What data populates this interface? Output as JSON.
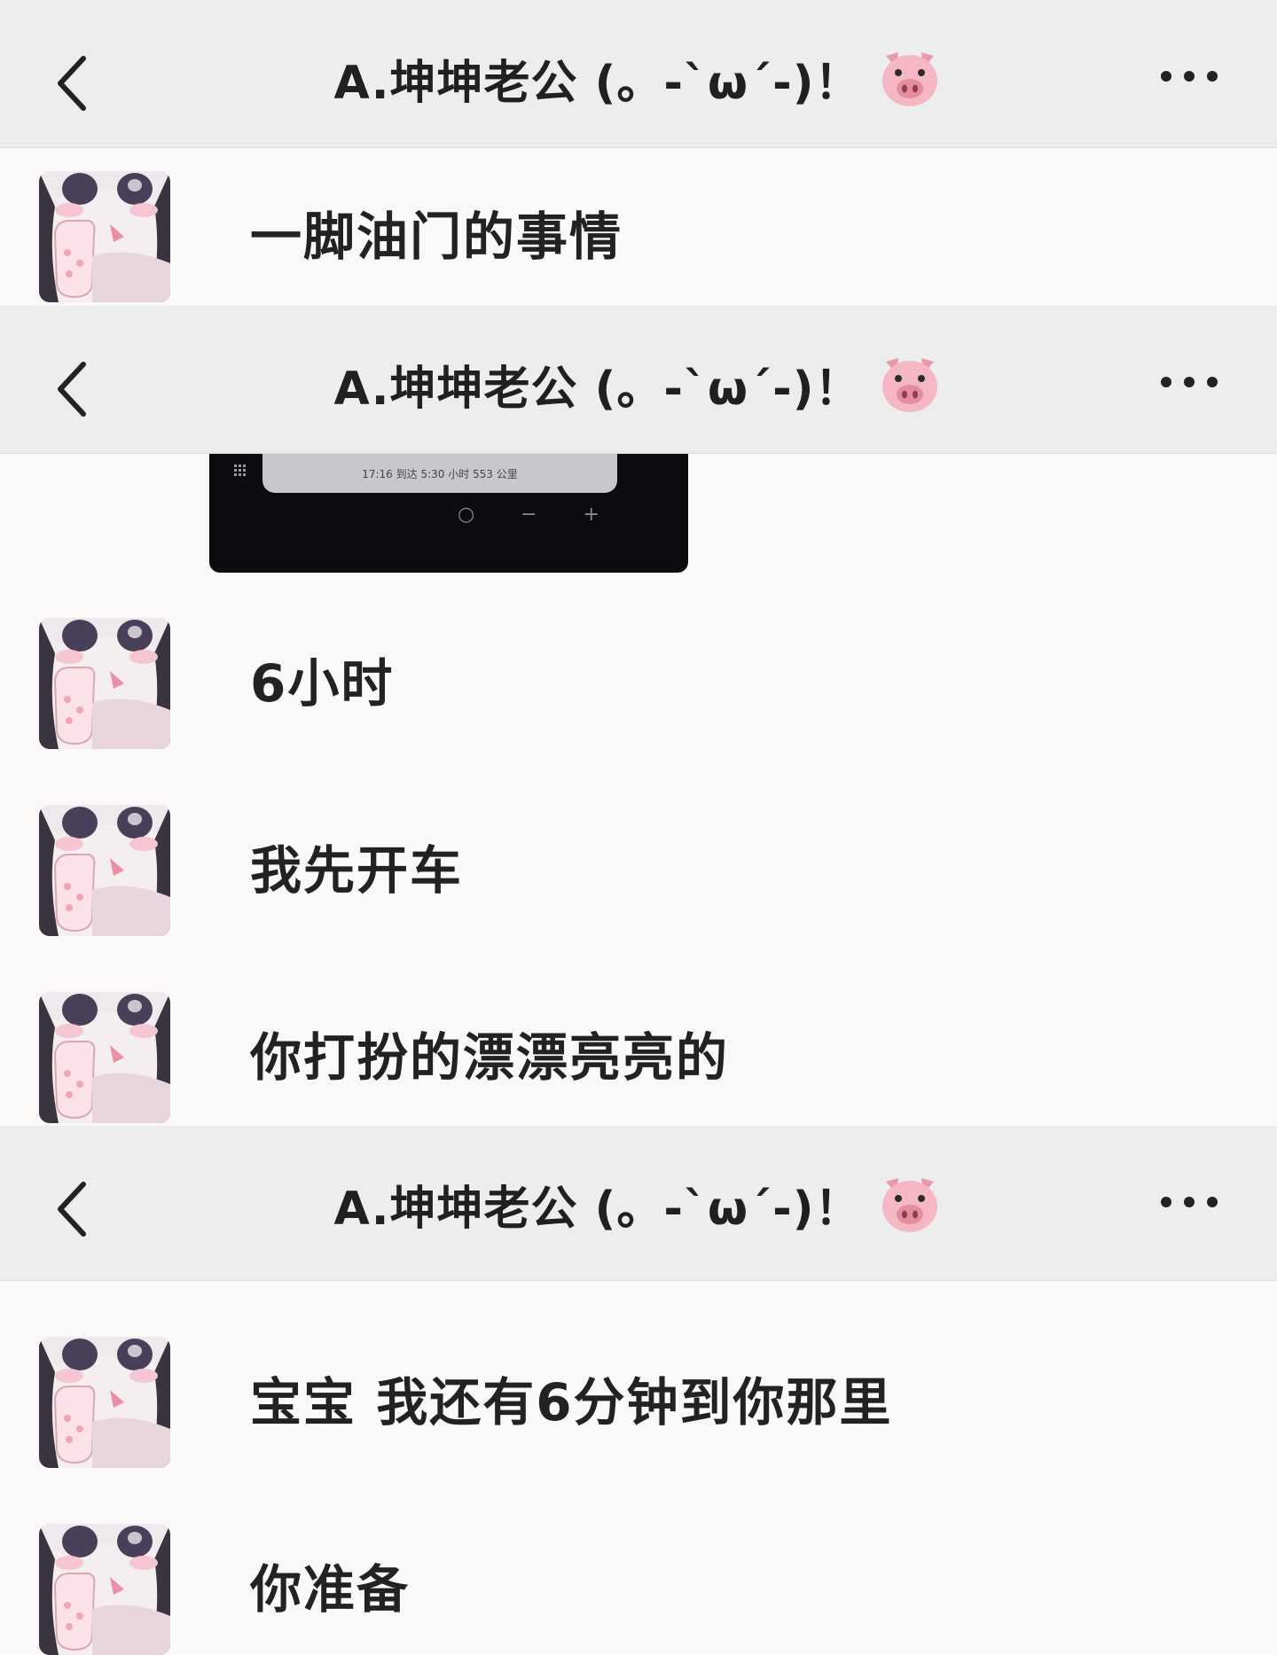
{
  "header": {
    "title": "A.坤坤老公 (。-`ω´-)！",
    "title_emoji_icon": "pig-face-icon",
    "back_icon": "chevron-left-icon",
    "more_icon": "more-dots-icon"
  },
  "panel1": {
    "messages": [
      {
        "text": "一脚油门的事情"
      }
    ]
  },
  "panel2": {
    "image_caption": "17:16 到达   5:30 小时   553 公里",
    "image_controls": [
      "○",
      "−",
      "+"
    ],
    "messages": [
      {
        "text": "6小时"
      },
      {
        "text": "我先开车"
      },
      {
        "text": "你打扮的漂漂亮亮的"
      }
    ]
  },
  "panel3": {
    "messages": [
      {
        "text": "宝宝 我还有6分钟到你那里"
      },
      {
        "text": "你准备"
      }
    ]
  },
  "colors": {
    "navbar_bg": "#ededed",
    "chat_bg": "#fbf8f9",
    "star_decor": "#f6dde3"
  }
}
